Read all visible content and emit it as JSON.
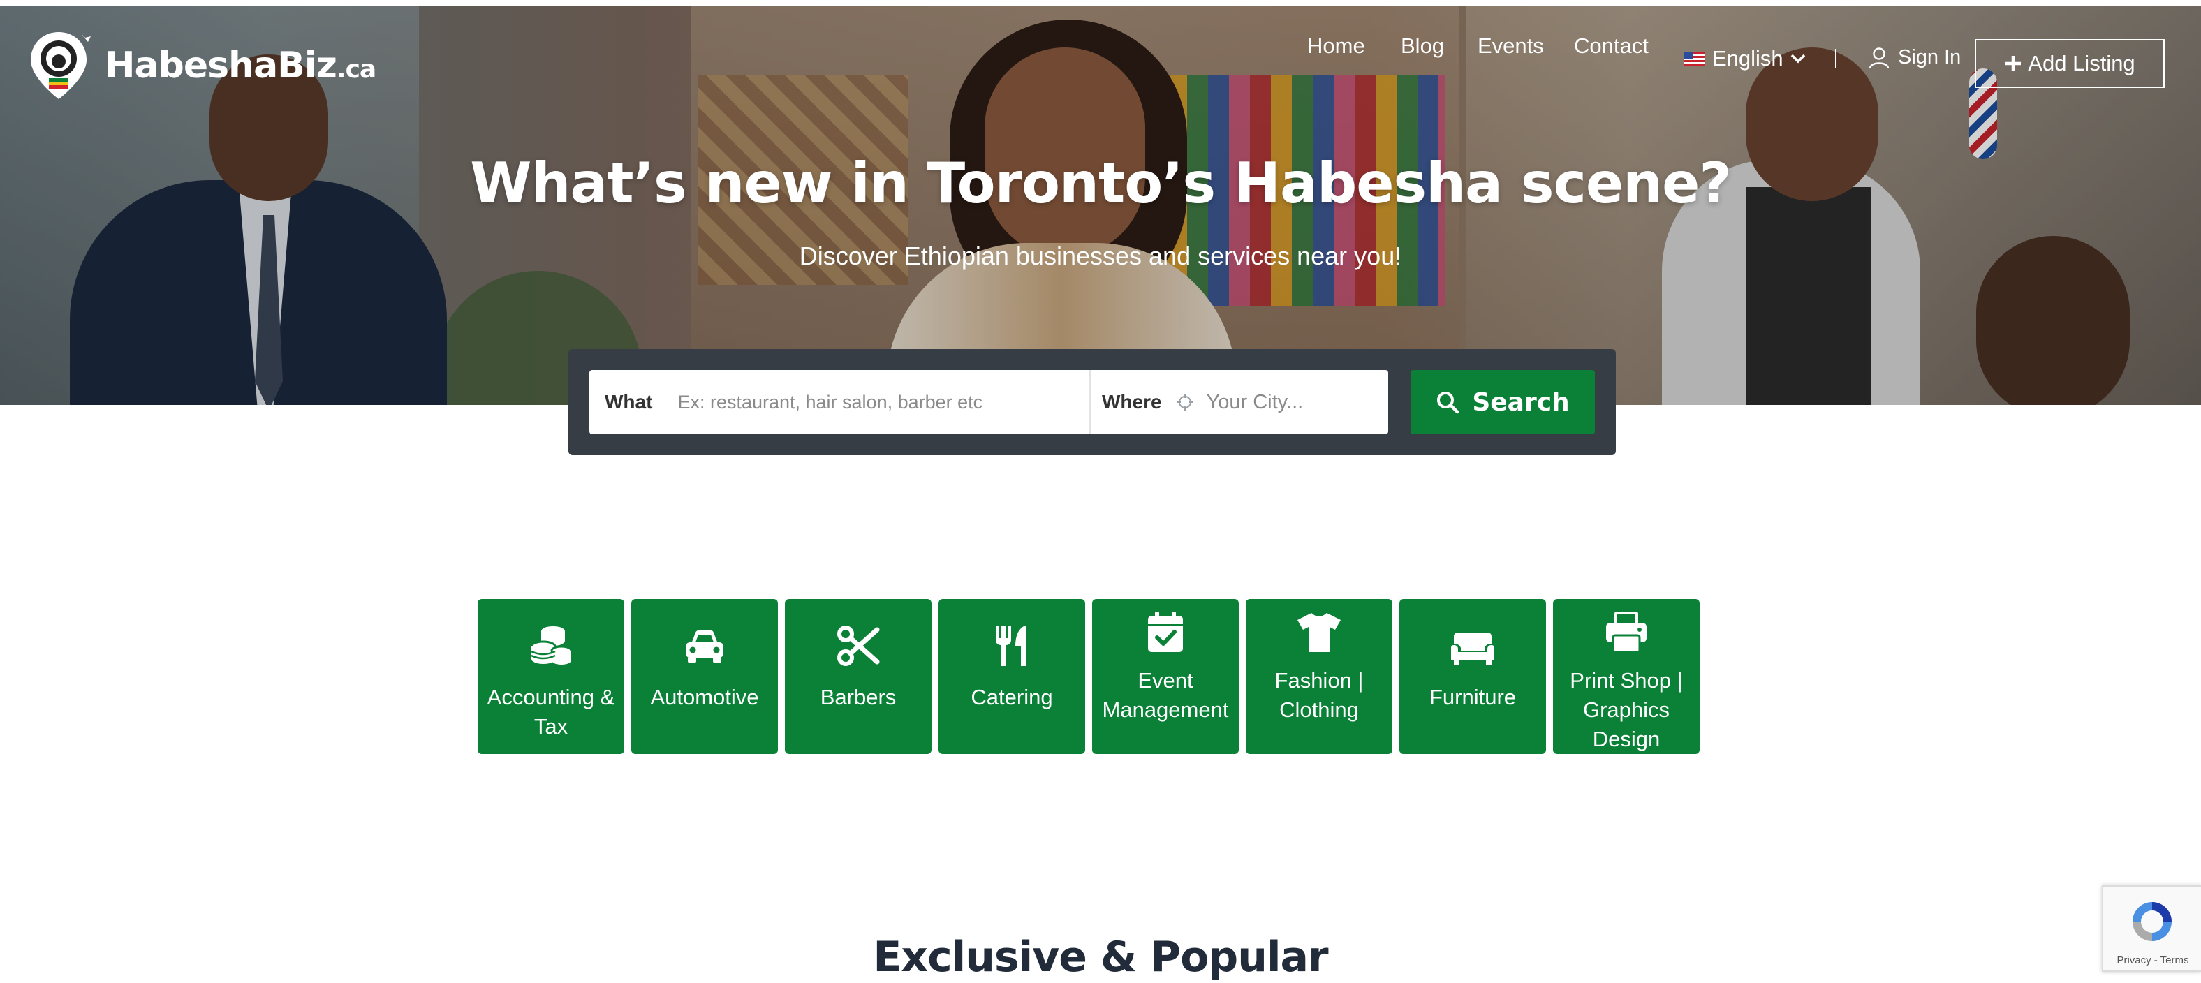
{
  "brand": {
    "name": "HabeshaBiz",
    "tld": ".ca"
  },
  "nav": {
    "items": [
      "Home",
      "Blog",
      "Events",
      "Contact"
    ],
    "language": "English",
    "separator": "|",
    "sign_in": "Sign In",
    "add_listing": "Add Listing"
  },
  "hero": {
    "title": "What’s new in Toronto’s Habesha scene?",
    "subtitle": "Discover Ethiopian businesses and services near you!"
  },
  "search": {
    "what_label": "What",
    "what_placeholder": "Ex: restaurant, hair salon, barber etc",
    "where_label": "Where",
    "where_placeholder": "Your City...",
    "button": "Search"
  },
  "categories": [
    {
      "label": "Accounting & Tax",
      "icon": "coins-icon"
    },
    {
      "label": "Automotive",
      "icon": "car-icon"
    },
    {
      "label": "Barbers",
      "icon": "scissors-icon"
    },
    {
      "label": "Catering",
      "icon": "utensils-icon"
    },
    {
      "label": "Event Management",
      "icon": "calendar-check-icon"
    },
    {
      "label": "Fashion | Clothing",
      "icon": "tshirt-icon"
    },
    {
      "label": "Furniture",
      "icon": "couch-icon"
    },
    {
      "label": "Print Shop | Graphics Design",
      "icon": "printer-icon"
    }
  ],
  "section": {
    "title": "Exclusive & Popular"
  },
  "recaptcha": {
    "terms": "Privacy - Terms"
  },
  "colors": {
    "accent": "#0a8137",
    "search_bg": "#363d45",
    "heading": "#222b3a"
  }
}
